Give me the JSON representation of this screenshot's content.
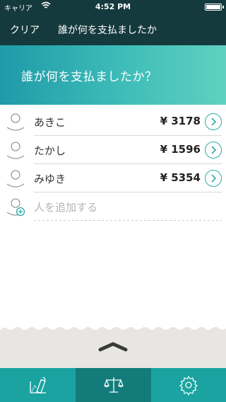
{
  "status_bar": {
    "carrier": "キャリア",
    "time": "4:52 PM"
  },
  "nav": {
    "clear_label": "クリア",
    "title": "誰が何を支払ましたか"
  },
  "header": {
    "prompt": "誰が何を支払ましたか？"
  },
  "people": [
    {
      "name": "あきこ",
      "amount": "¥ 3178"
    },
    {
      "name": "たかし",
      "amount": "¥ 1596"
    },
    {
      "name": "みゆき",
      "amount": "¥ 5354"
    }
  ],
  "add_person": {
    "placeholder": "人を追加する"
  },
  "tabs": [
    {
      "icon": "chart-edit-icon"
    },
    {
      "icon": "scale-balance-icon",
      "selected": true
    },
    {
      "icon": "gear-icon"
    }
  ],
  "colors": {
    "nav": "#153a3d",
    "accent": "#2fa9a6",
    "tab_bar": "#1aa3a0",
    "tab_selected": "#137c7a"
  }
}
